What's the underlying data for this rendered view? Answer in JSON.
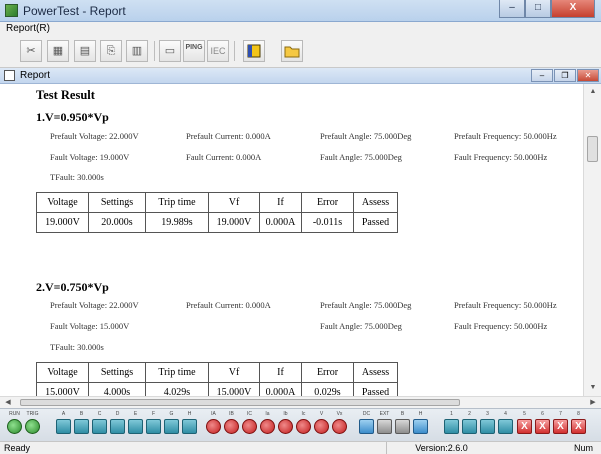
{
  "window": {
    "title": "PowerTest - Report",
    "minimize": "–",
    "maximize": "□",
    "close": "X"
  },
  "menu": {
    "report": "Report(R)"
  },
  "toolbar": {
    "ping_label": "PING",
    "iec_label": "IEC"
  },
  "inner_window": {
    "title": "Report"
  },
  "report": {
    "heading": "Test Result",
    "sections": [
      {
        "title": "1.V=0.950*Vp",
        "prefault_voltage": "Prefault Voltage: 22.000V",
        "prefault_current": "Prefault Current: 0.000A",
        "prefault_angle": "Prefault Angle: 75.000Deg",
        "prefault_frequency": "Prefault Frequency: 50.000Hz",
        "fault_voltage": "Fault Voltage: 19.000V",
        "fault_current": "Fault Current: 0.000A",
        "fault_angle": "Fault Angle: 75.000Deg",
        "fault_frequency": "Fault Frequency: 50.000Hz",
        "tfault": "TFault: 30.000s",
        "row": [
          "19.000V",
          "20.000s",
          "19.989s",
          "19.000V",
          "0.000A",
          "-0.011s",
          "Passed"
        ]
      },
      {
        "title": "2.V=0.750*Vp",
        "prefault_voltage": "Prefault Voltage: 22.000V",
        "prefault_current": "Prefault Current: 0.000A",
        "prefault_angle": "Prefault Angle: 75.000Deg",
        "prefault_frequency": "Prefault Frequency: 50.000Hz",
        "fault_voltage": "Fault Voltage: 15.000V",
        "fault_current": "",
        "fault_angle": "Fault Angle: 75.000Deg",
        "fault_frequency": "Fault Frequency: 50.000Hz",
        "tfault": "TFault: 30.000s",
        "row": [
          "15.000V",
          "4.000s",
          "4.029s",
          "15.000V",
          "0.000A",
          "0.029s",
          "Passed"
        ]
      }
    ],
    "columns": [
      "Voltage",
      "Settings",
      "Trip time",
      "Vf",
      "If",
      "Error",
      "Assess"
    ]
  },
  "panel": {
    "labels": [
      "RUN",
      "TRIG",
      "A",
      "B",
      "C",
      "D",
      "E",
      "F",
      "G",
      "H",
      "IA",
      "IB",
      "IC",
      "Ia",
      "Ib",
      "Ic",
      "V",
      "Vx",
      "DC",
      "EXT",
      "B",
      "H",
      "1",
      "2",
      "3",
      "4",
      "5",
      "6",
      "7",
      "8"
    ],
    "x_mark": "X"
  },
  "status": {
    "ready": "Ready",
    "version": "Version:2.6.0",
    "num": "Num"
  },
  "colors": {
    "passed_border": "#555555",
    "title_bar": "#c3d6ee"
  }
}
